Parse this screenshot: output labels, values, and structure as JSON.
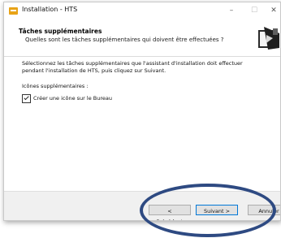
{
  "window": {
    "title": "Installation - HTS",
    "controls": {
      "minimize": "–",
      "maximize": "☐",
      "close": "✕"
    }
  },
  "header": {
    "title": "Tâches supplémentaires",
    "subtitle": "Quelles sont les tâches supplémentaires qui doivent être effectuées ?",
    "logo_icon": "installer-logo-icon"
  },
  "content": {
    "instructions": "Sélectionnez les tâches supplémentaires que l'assistant d'installation doit effectuer pendant l'installation de HTS, puis cliquez sur Suivant.",
    "group_label": "Icônes supplémentaires :",
    "checkbox_label": "Créer une icône sur le Bureau",
    "checkbox_checked": true
  },
  "footer": {
    "back_label": "< Précédent",
    "next_label": "Suivant >",
    "cancel_label": "Annuler"
  },
  "colors": {
    "annotation_ellipse": "#2e4a82",
    "app_icon": "#e8a317",
    "default_button_border": "#0078d7"
  }
}
